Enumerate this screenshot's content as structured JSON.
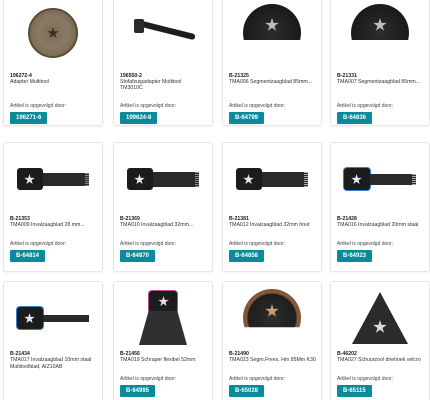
{
  "availability_label": "Artikel is opgevolgd door:",
  "products": [
    {
      "code": "196272-4",
      "name": "Adapter Multitool",
      "successor": "196271-6",
      "icon": "adapter-disc-icon"
    },
    {
      "code": "196550-2",
      "name": "Stofafzuigadapter Multitool",
      "name2": "TM3010C",
      "successor": "199624-8",
      "icon": "dust-adapter-icon"
    },
    {
      "code": "B-21325",
      "name": "TMA006 Segmentzaagblad 85mm...",
      "successor": "B-64799",
      "icon": "segment-saw-disc-icon"
    },
    {
      "code": "B-21331",
      "name": "TMA007 Segmentzaagblad 85mm...",
      "successor": "B-64836",
      "icon": "segment-saw-disc-icon"
    },
    {
      "code": "B-21353",
      "name": "TMA009 Invalzaagblad 28 mm...",
      "successor": "B-64814",
      "icon": "plunge-blade-icon"
    },
    {
      "code": "B-21369",
      "name": "TMA010 Invalzaagblad 32mm...",
      "successor": "B-64870",
      "icon": "plunge-blade-icon"
    },
    {
      "code": "B-21381",
      "name": "TMA012 Invalzaagblad 32mm hout",
      "successor": "B-64858",
      "icon": "plunge-blade-icon"
    },
    {
      "code": "B-21428",
      "name": "TMA016 Invalzaagblad 20mm staal",
      "successor": "B-64923",
      "icon": "plunge-blade-icon"
    },
    {
      "code": "B-21434",
      "name": "TMA017 Invalzaagblad 10mm staal",
      "name2": "Multitoolblad, AIZ10AB",
      "successor": "",
      "icon": "narrow-blade-icon"
    },
    {
      "code": "B-21456",
      "name": "TMA019 Schraper flexibel 52mm",
      "successor": "B-64995",
      "icon": "scraper-icon"
    },
    {
      "code": "B-21490",
      "name": "TMA023 Segm.Frees. Hm 85Mm K30",
      "successor": "B-65028",
      "icon": "carbide-disc-icon"
    },
    {
      "code": "B-46202",
      "name": "TMA027 Schuurzool driehoek velcro",
      "successor": "B-65115",
      "icon": "sanding-pad-icon"
    }
  ],
  "colors": {
    "button": "#0b8a9c",
    "button_text": "#ffffff",
    "card_border": "#e6e6e6"
  }
}
